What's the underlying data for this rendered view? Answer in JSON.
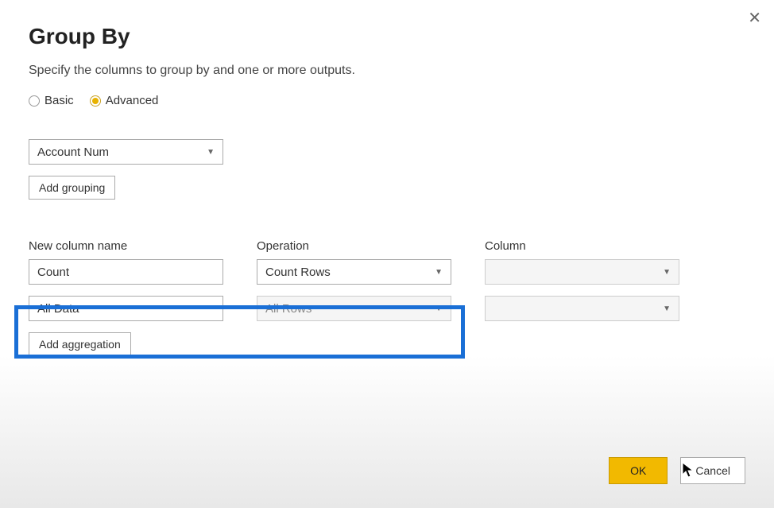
{
  "dialog": {
    "title": "Group By",
    "subtitle": "Specify the columns to group by and one or more outputs.",
    "close_icon": "✕"
  },
  "mode": {
    "basic_label": "Basic",
    "advanced_label": "Advanced",
    "selected": "Advanced"
  },
  "grouping": {
    "column_select": "Account Num",
    "add_button": "Add grouping"
  },
  "headers": {
    "new_col": "New column name",
    "operation": "Operation",
    "column": "Column"
  },
  "aggregations": [
    {
      "name": "Count",
      "operation": "Count Rows",
      "column": "",
      "operation_disabled": false,
      "column_disabled": true
    },
    {
      "name": "All Data",
      "operation": "All Rows",
      "column": "",
      "operation_disabled": true,
      "column_disabled": true
    }
  ],
  "add_aggregation_label": "Add aggregation",
  "footer": {
    "ok": "OK",
    "cancel": "Cancel"
  }
}
